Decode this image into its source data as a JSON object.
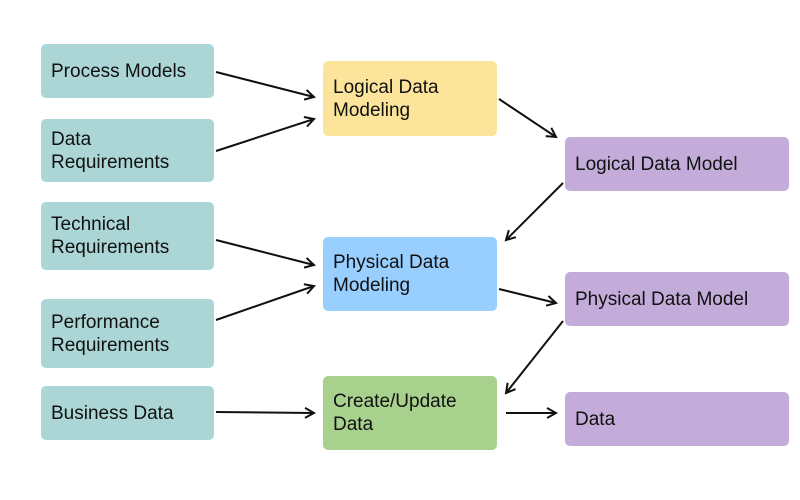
{
  "colors": {
    "inputs": "#acd6d6",
    "logical_modeling": "#fce59a",
    "physical_modeling": "#99cfff",
    "create_update": "#a9d18e",
    "outputs": "#c3acd9",
    "arrow": "#111111"
  },
  "inputs": [
    "Process Models",
    "Data Requirements",
    "Technical Requirements",
    "Performance Requirements",
    "Business Data"
  ],
  "processes": [
    "Logical Data Modeling",
    "Physical Data Modeling",
    "Create/Update Data"
  ],
  "outputs": [
    "Logical Data Model",
    "Physical Data Model",
    "Data"
  ]
}
